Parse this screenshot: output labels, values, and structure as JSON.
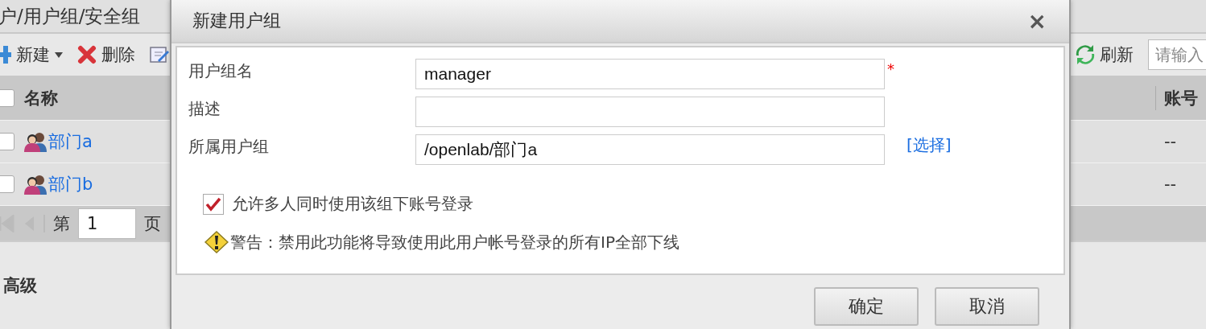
{
  "page": {
    "breadcrumb": "户/用户组/安全组"
  },
  "toolbar": {
    "buttons": [
      {
        "label": "新建",
        "kind": "new"
      },
      {
        "label": "删除",
        "kind": "delete"
      },
      {
        "kind": "edit"
      },
      {
        "label": "刷新",
        "kind": "refresh"
      }
    ],
    "search": {
      "placeholder": "请输入"
    }
  },
  "table": {
    "header_checked": false,
    "columns": [
      "名称",
      "账号"
    ],
    "rows": [
      {
        "name": "部门a",
        "account": "--",
        "checked": false
      },
      {
        "name": "部门b",
        "account": "--",
        "checked": false
      }
    ]
  },
  "pager": {
    "label": "第",
    "page": "1",
    "suffix": "页"
  },
  "section": "高级",
  "dialog": {
    "title": "新建用户组",
    "close": "×",
    "required_mark": "*",
    "fields": [
      {
        "label": "用户组名",
        "value": "manager",
        "required": true
      },
      {
        "label": "描述",
        "required": false
      },
      {
        "label": "所属用户组",
        "value": "/openlab/部门a",
        "required": false,
        "action": "[选择]"
      }
    ],
    "option": {
      "label": "允许多人同时使用该组下账号登录",
      "checked": true
    },
    "warning": "警告：禁用此功能将导致使用此用户帐号登录的所有IP全部下线",
    "buttons": [
      "确定",
      "取消"
    ]
  }
}
